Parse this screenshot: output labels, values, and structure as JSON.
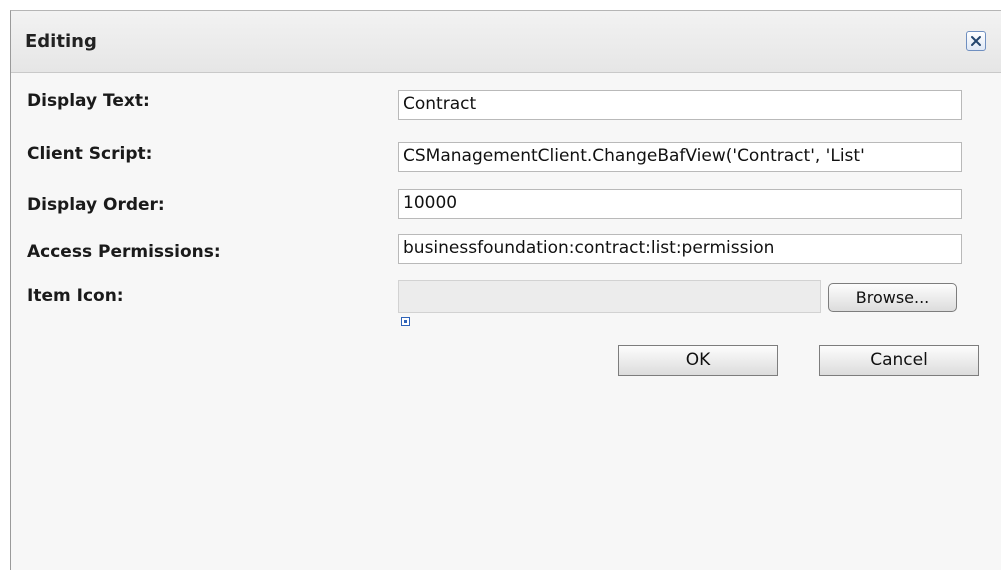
{
  "dialog": {
    "title": "Editing",
    "close_icon": "close-icon"
  },
  "form": {
    "display_text": {
      "label": "Display Text:",
      "value": "Contract"
    },
    "client_script": {
      "label": "Client Script:",
      "value": "CSManagementClient.ChangeBafView('Contract', 'List'"
    },
    "display_order": {
      "label": "Display Order:",
      "value": "10000"
    },
    "access_permissions": {
      "label": "Access Permissions:",
      "value": "businessfoundation:contract:list:permission"
    },
    "item_icon": {
      "label": "Item Icon:",
      "value": "",
      "browse_label": "Browse..."
    }
  },
  "buttons": {
    "ok_label": "OK",
    "cancel_label": "Cancel"
  },
  "colors": {
    "accent": "#2f63b8",
    "titlebar": "#ececec"
  }
}
